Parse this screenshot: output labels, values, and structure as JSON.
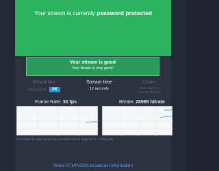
{
  "banner": {
    "prefix": "Your stream is currently ",
    "emphasis": "password protected"
  },
  "status": {
    "title": "Your stream is good",
    "subtitle": "Your bitrate is very good!"
  },
  "resolution": {
    "label": "Resolution",
    "value": "3840x2160",
    "badge": "4K"
  },
  "stream_time": {
    "label": "Stream time",
    "value": "12 seconds"
  },
  "codec": {
    "label": "Codec",
    "line1": "H264 High 5.1",
    "line2": "AAC-LC 48.0kHz"
  },
  "frame_rate": {
    "label": "Frame Rate:",
    "value": "30 fps"
  },
  "bitrate": {
    "label": "Bitrate:",
    "value": "28565 bitrate",
    "peak": "37570"
  },
  "footer": {
    "connected": "Connected to origin a.pho.live.minuscle.com in region PHX - Using obs"
  },
  "link": {
    "label": "Show RTMP/OBS broadcast information"
  },
  "colors": {
    "banner": "#2cb360",
    "good_box": "#2a9b58",
    "badge": "#1aa0d6",
    "link": "#5a9ee8",
    "chart_line": "#3a8fe0"
  }
}
